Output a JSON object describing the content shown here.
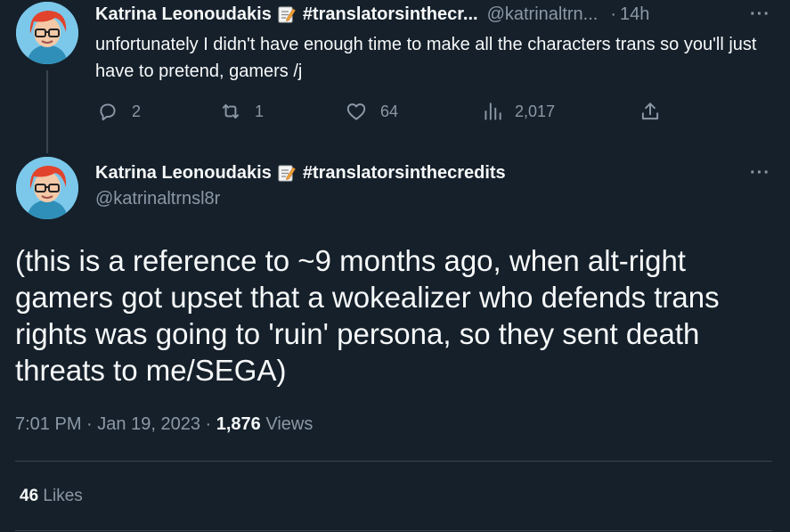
{
  "reply_tweet": {
    "author_name": "Katrina Leonoudakis",
    "hashtag": "#translatorsinthecr...",
    "handle": "@katrinaltrn...",
    "separator": "·",
    "time_ago": "14h",
    "more_label": "···",
    "text": "unfortunately I didn't have enough time to make all the characters trans so you'll just have to pretend, gamers /j",
    "actions": {
      "replies": "2",
      "retweets": "1",
      "likes": "64",
      "views": "2,017"
    }
  },
  "main_tweet": {
    "author_name": "Katrina Leonoudakis",
    "hashtag": "#translatorsinthecredits",
    "handle": "@katrinaltrnsl8r",
    "more_label": "···",
    "text": "(this is a reference to ~9 months ago, when alt-right gamers got upset that a wokealizer who defends trans rights was going to 'ruin' persona, so they sent death threats to me/SEGA)",
    "time": "7:01 PM",
    "dot": "·",
    "date": "Jan 19, 2023",
    "views_count": "1,876",
    "views_label": "Views",
    "likes_count": "46",
    "likes_label": "Likes"
  },
  "colors": {
    "background": "#15202b",
    "text": "#f7f9f9",
    "muted": "#8b98a5",
    "divider": "#38444d"
  },
  "icons": [
    "avatar",
    "memo-emoji-icon",
    "reply-icon",
    "retweet-icon",
    "like-icon",
    "views-icon",
    "share-icon",
    "more-icon"
  ]
}
